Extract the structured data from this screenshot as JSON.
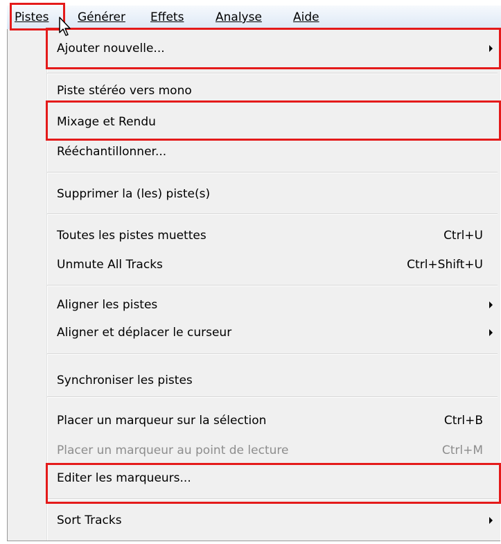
{
  "menubar": {
    "items": [
      {
        "label": "Pistes"
      },
      {
        "label": "Générer"
      },
      {
        "label": "Effets"
      },
      {
        "label": "Analyse"
      },
      {
        "label": "Aide"
      }
    ]
  },
  "menu": {
    "items": [
      {
        "label": "Ajouter nouvelle...",
        "submenu": true
      },
      {
        "label": "Piste stéréo vers mono"
      },
      {
        "label": "Mixage et Rendu"
      },
      {
        "label": "Rééchantillonner..."
      },
      {
        "label": "Supprimer la (les) piste(s)"
      },
      {
        "label": "Toutes les pistes muettes",
        "shortcut": "Ctrl+U"
      },
      {
        "label": "Unmute All Tracks",
        "shortcut": "Ctrl+Shift+U"
      },
      {
        "label": "Aligner les pistes",
        "submenu": true
      },
      {
        "label": "Aligner et déplacer le curseur",
        "submenu": true
      },
      {
        "label": "Synchroniser les pistes"
      },
      {
        "label": "Placer un marqueur sur la sélection",
        "shortcut": "Ctrl+B"
      },
      {
        "label": "Placer un marqueur au point de lecture",
        "shortcut": "Ctrl+M",
        "disabled": true
      },
      {
        "label": "Editer les marqueurs..."
      },
      {
        "label": "Sort Tracks",
        "submenu": true
      }
    ]
  },
  "colors": {
    "highlight": "#e41a1a",
    "disabled_text": "#8d8d8d"
  }
}
